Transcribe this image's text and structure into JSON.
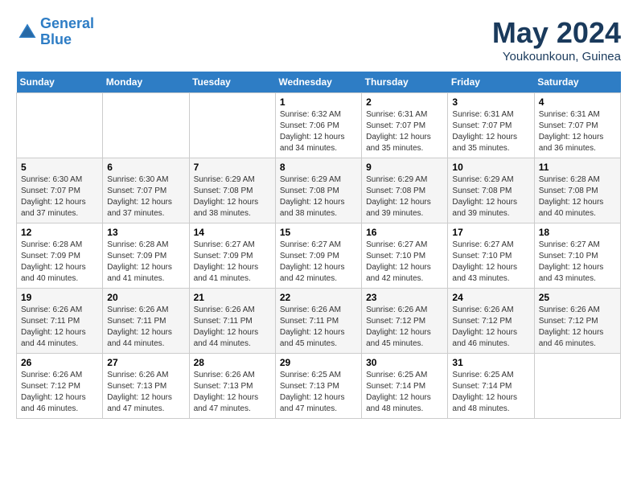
{
  "header": {
    "logo_line1": "General",
    "logo_line2": "Blue",
    "month": "May 2024",
    "location": "Youkounkoun, Guinea"
  },
  "days_of_week": [
    "Sunday",
    "Monday",
    "Tuesday",
    "Wednesday",
    "Thursday",
    "Friday",
    "Saturday"
  ],
  "weeks": [
    {
      "days": [
        {
          "num": "",
          "info": ""
        },
        {
          "num": "",
          "info": ""
        },
        {
          "num": "",
          "info": ""
        },
        {
          "num": "1",
          "info": "Sunrise: 6:32 AM\nSunset: 7:06 PM\nDaylight: 12 hours\nand 34 minutes."
        },
        {
          "num": "2",
          "info": "Sunrise: 6:31 AM\nSunset: 7:07 PM\nDaylight: 12 hours\nand 35 minutes."
        },
        {
          "num": "3",
          "info": "Sunrise: 6:31 AM\nSunset: 7:07 PM\nDaylight: 12 hours\nand 35 minutes."
        },
        {
          "num": "4",
          "info": "Sunrise: 6:31 AM\nSunset: 7:07 PM\nDaylight: 12 hours\nand 36 minutes."
        }
      ]
    },
    {
      "days": [
        {
          "num": "5",
          "info": "Sunrise: 6:30 AM\nSunset: 7:07 PM\nDaylight: 12 hours\nand 37 minutes."
        },
        {
          "num": "6",
          "info": "Sunrise: 6:30 AM\nSunset: 7:07 PM\nDaylight: 12 hours\nand 37 minutes."
        },
        {
          "num": "7",
          "info": "Sunrise: 6:29 AM\nSunset: 7:08 PM\nDaylight: 12 hours\nand 38 minutes."
        },
        {
          "num": "8",
          "info": "Sunrise: 6:29 AM\nSunset: 7:08 PM\nDaylight: 12 hours\nand 38 minutes."
        },
        {
          "num": "9",
          "info": "Sunrise: 6:29 AM\nSunset: 7:08 PM\nDaylight: 12 hours\nand 39 minutes."
        },
        {
          "num": "10",
          "info": "Sunrise: 6:29 AM\nSunset: 7:08 PM\nDaylight: 12 hours\nand 39 minutes."
        },
        {
          "num": "11",
          "info": "Sunrise: 6:28 AM\nSunset: 7:08 PM\nDaylight: 12 hours\nand 40 minutes."
        }
      ]
    },
    {
      "days": [
        {
          "num": "12",
          "info": "Sunrise: 6:28 AM\nSunset: 7:09 PM\nDaylight: 12 hours\nand 40 minutes."
        },
        {
          "num": "13",
          "info": "Sunrise: 6:28 AM\nSunset: 7:09 PM\nDaylight: 12 hours\nand 41 minutes."
        },
        {
          "num": "14",
          "info": "Sunrise: 6:27 AM\nSunset: 7:09 PM\nDaylight: 12 hours\nand 41 minutes."
        },
        {
          "num": "15",
          "info": "Sunrise: 6:27 AM\nSunset: 7:09 PM\nDaylight: 12 hours\nand 42 minutes."
        },
        {
          "num": "16",
          "info": "Sunrise: 6:27 AM\nSunset: 7:10 PM\nDaylight: 12 hours\nand 42 minutes."
        },
        {
          "num": "17",
          "info": "Sunrise: 6:27 AM\nSunset: 7:10 PM\nDaylight: 12 hours\nand 43 minutes."
        },
        {
          "num": "18",
          "info": "Sunrise: 6:27 AM\nSunset: 7:10 PM\nDaylight: 12 hours\nand 43 minutes."
        }
      ]
    },
    {
      "days": [
        {
          "num": "19",
          "info": "Sunrise: 6:26 AM\nSunset: 7:11 PM\nDaylight: 12 hours\nand 44 minutes."
        },
        {
          "num": "20",
          "info": "Sunrise: 6:26 AM\nSunset: 7:11 PM\nDaylight: 12 hours\nand 44 minutes."
        },
        {
          "num": "21",
          "info": "Sunrise: 6:26 AM\nSunset: 7:11 PM\nDaylight: 12 hours\nand 44 minutes."
        },
        {
          "num": "22",
          "info": "Sunrise: 6:26 AM\nSunset: 7:11 PM\nDaylight: 12 hours\nand 45 minutes."
        },
        {
          "num": "23",
          "info": "Sunrise: 6:26 AM\nSunset: 7:12 PM\nDaylight: 12 hours\nand 45 minutes."
        },
        {
          "num": "24",
          "info": "Sunrise: 6:26 AM\nSunset: 7:12 PM\nDaylight: 12 hours\nand 46 minutes."
        },
        {
          "num": "25",
          "info": "Sunrise: 6:26 AM\nSunset: 7:12 PM\nDaylight: 12 hours\nand 46 minutes."
        }
      ]
    },
    {
      "days": [
        {
          "num": "26",
          "info": "Sunrise: 6:26 AM\nSunset: 7:12 PM\nDaylight: 12 hours\nand 46 minutes."
        },
        {
          "num": "27",
          "info": "Sunrise: 6:26 AM\nSunset: 7:13 PM\nDaylight: 12 hours\nand 47 minutes."
        },
        {
          "num": "28",
          "info": "Sunrise: 6:26 AM\nSunset: 7:13 PM\nDaylight: 12 hours\nand 47 minutes."
        },
        {
          "num": "29",
          "info": "Sunrise: 6:25 AM\nSunset: 7:13 PM\nDaylight: 12 hours\nand 47 minutes."
        },
        {
          "num": "30",
          "info": "Sunrise: 6:25 AM\nSunset: 7:14 PM\nDaylight: 12 hours\nand 48 minutes."
        },
        {
          "num": "31",
          "info": "Sunrise: 6:25 AM\nSunset: 7:14 PM\nDaylight: 12 hours\nand 48 minutes."
        },
        {
          "num": "",
          "info": ""
        }
      ]
    }
  ]
}
